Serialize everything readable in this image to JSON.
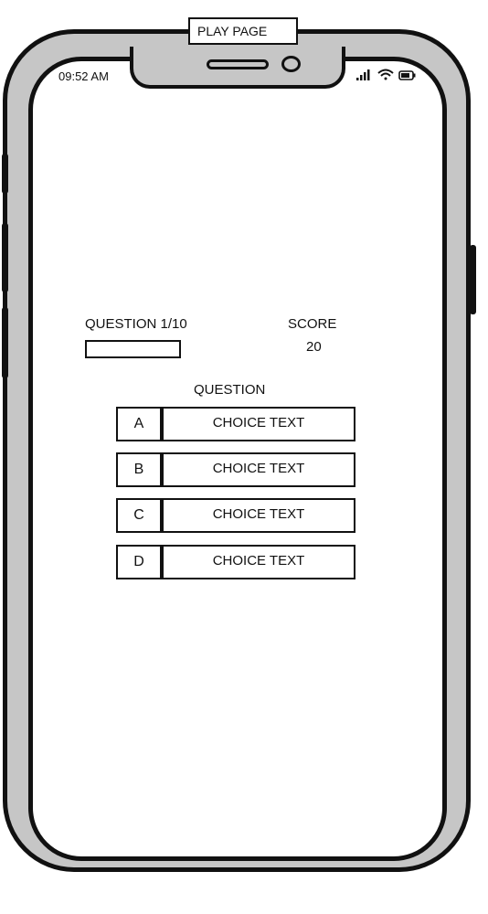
{
  "page": {
    "title": "PLAY PAGE"
  },
  "status_bar": {
    "time": "09:52 AM",
    "icons": [
      "signal-icon",
      "wifi-icon",
      "battery-icon"
    ]
  },
  "game": {
    "question_label": "QUESTION 1/10",
    "progress": 0,
    "score_label": "SCORE",
    "score_value": "20",
    "question_text": "QUESTION",
    "choices": [
      {
        "letter": "A",
        "text": "CHOICE TEXT"
      },
      {
        "letter": "B",
        "text": "CHOICE TEXT"
      },
      {
        "letter": "C",
        "text": "CHOICE TEXT"
      },
      {
        "letter": "D",
        "text": "CHOICE TEXT"
      }
    ]
  }
}
